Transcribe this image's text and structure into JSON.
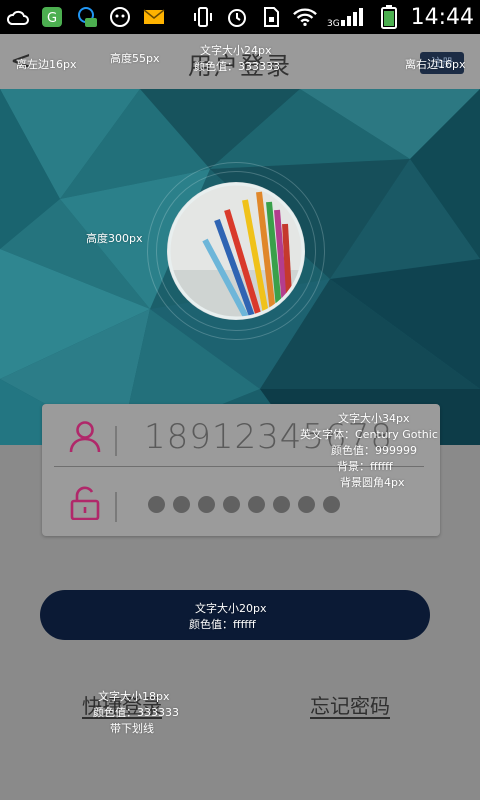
{
  "status_bar": {
    "time": "14:44",
    "left_icons": [
      "cloud-icon",
      "app-icon",
      "qq-icon",
      "wechat-icon",
      "mail-icon"
    ],
    "right_icons": [
      "vibrate-icon",
      "alarm-icon",
      "sim-icon",
      "wifi-icon",
      "signal-icon",
      "battery-icon"
    ],
    "network_label": "3G"
  },
  "header": {
    "back_glyph": "<",
    "title": "用户登录",
    "right_button": "注册"
  },
  "annotations": {
    "left_margin": "离左边16px",
    "height": "高度55px",
    "title_font": "文字大小24px",
    "title_color": "颜色值：333333",
    "right_margin": "离右边16px",
    "hero_height": "高度300px",
    "field_size": "文字大小34px",
    "field_font": "英文字体：Century Gothic",
    "field_color": "颜色值：999999",
    "field_bg": "背景：ffffff",
    "field_radius": "背景圆角4px",
    "button_font": "文字大小20px",
    "button_color": "颜色值：ffffff",
    "link_font": "文字大小18px",
    "link_color": "颜色值：333333",
    "link_underline": "带下划线"
  },
  "form": {
    "username": "18912345678",
    "password_dots": 8
  },
  "links": {
    "quick_login": "快捷登录",
    "forgot_password": "忘记密码"
  },
  "colors": {
    "accent": "#c2185b",
    "button": "#0b1a35",
    "hero": "#1f6d78"
  }
}
